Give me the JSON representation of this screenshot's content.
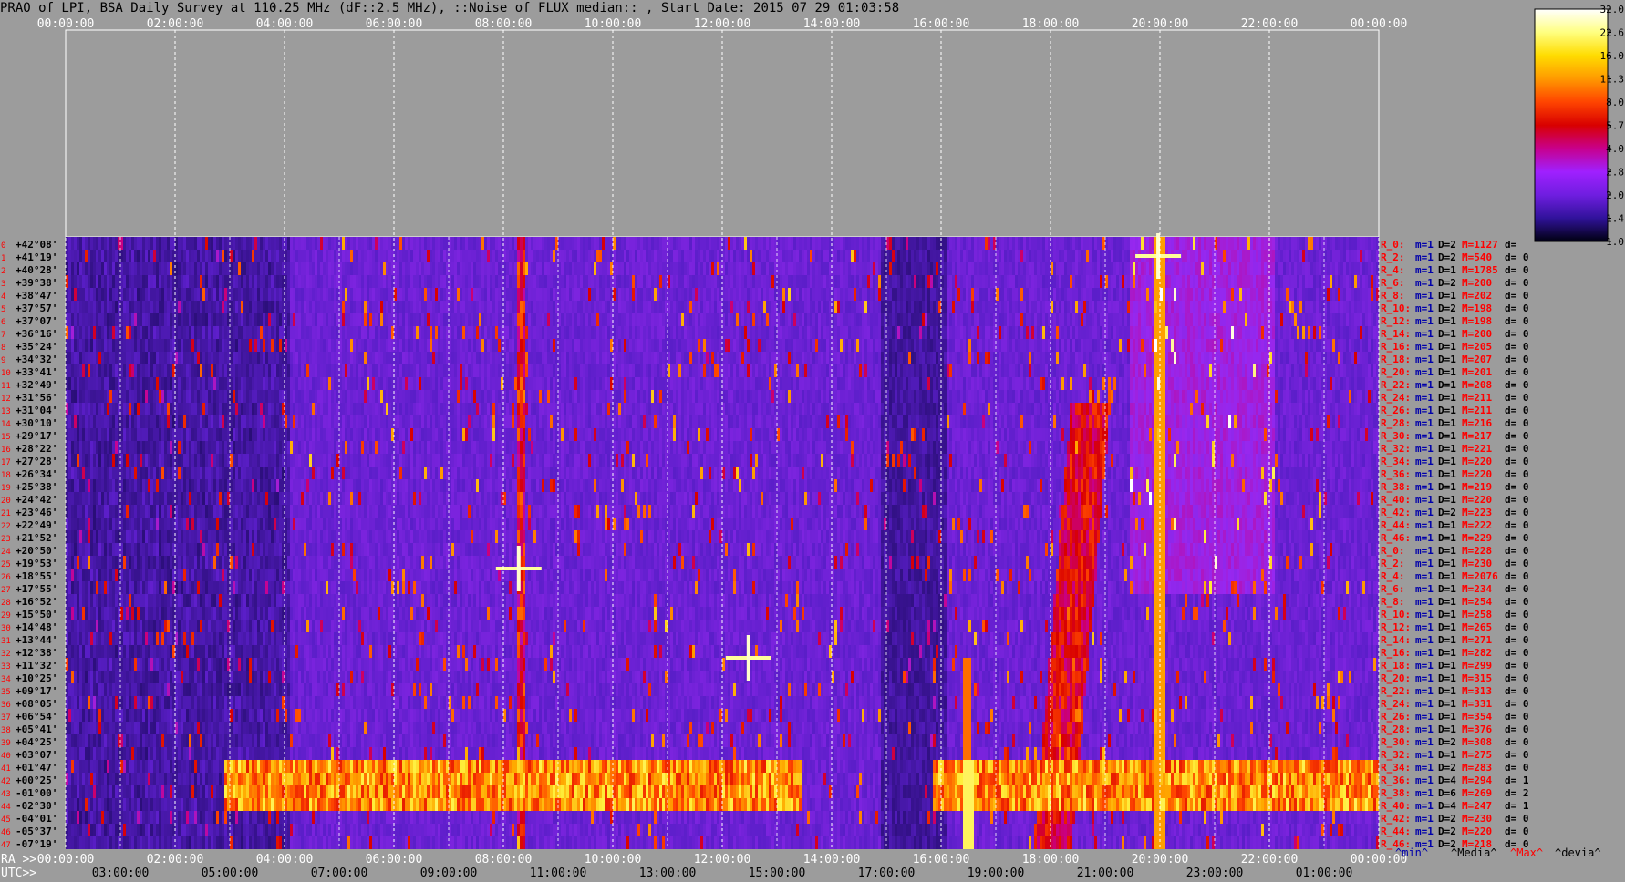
{
  "title": "PRAO of LPI, BSA Daily Survey at 110.25 MHz (dF::2.5 MHz), ::Noise_of_FLUX_median:: , Start Date: 2015 07 29 01:03:58",
  "chart_data": {
    "type": "heatmap",
    "title": "PRAO of LPI, BSA Daily Survey at 110.25 MHz (dF::2.5 MHz), ::Noise_of_FLUX_median:: , Start Date: 2015 07 29 01:03:58",
    "ra_prefix": "RA >>",
    "utc_prefix": "UTC>>",
    "top_ticks": [
      "00:00:00",
      "02:00:00",
      "04:00:00",
      "06:00:00",
      "08:00:00",
      "10:00:00",
      "12:00:00",
      "14:00:00",
      "16:00:00",
      "18:00:00",
      "20:00:00",
      "22:00:00",
      "00:00:00"
    ],
    "bottom_ra_ticks": [
      "00:00:00",
      "02:00:00",
      "04:00:00",
      "06:00:00",
      "08:00:00",
      "10:00:00",
      "12:00:00",
      "14:00:00",
      "16:00:00",
      "18:00:00",
      "20:00:00",
      "22:00:00",
      "00:00:00"
    ],
    "bottom_utc_ticks": [
      "03:00:00",
      "05:00:00",
      "07:00:00",
      "09:00:00",
      "11:00:00",
      "13:00:00",
      "15:00:00",
      "17:00:00",
      "19:00:00",
      "21:00:00",
      "23:00:00",
      "01:00:00"
    ],
    "declinations": [
      "+42°08'",
      "+41°19'",
      "+40°28'",
      "+39°38'",
      "+38°47'",
      "+37°57'",
      "+37°07'",
      "+36°16'",
      "+35°24'",
      "+34°32'",
      "+33°41'",
      "+32°49'",
      "+31°56'",
      "+31°04'",
      "+30°10'",
      "+29°17'",
      "+28°22'",
      "+27°28'",
      "+26°34'",
      "+25°38'",
      "+24°42'",
      "+23°46'",
      "+22°49'",
      "+21°52'",
      "+20°50'",
      "+19°53'",
      "+18°55'",
      "+17°55'",
      "+16°52'",
      "+15°50'",
      "+14°48'",
      "+13°44'",
      "+12°38'",
      "+11°32'",
      "+10°25'",
      "+09°17'",
      "+08°05'",
      "+06°54'",
      "+05°41'",
      "+04°25'",
      "+03°07'",
      "+01°47'",
      "+00°25'",
      "-01°00'",
      "-02°30'",
      "-04°01'",
      "-05°37'",
      "-07°19'"
    ],
    "row_indices": [
      "0",
      "1",
      "2",
      "3",
      "4",
      "5",
      "6",
      "7",
      "8",
      "9",
      "10",
      "11",
      "12",
      "13",
      "14",
      "15",
      "16",
      "17",
      "18",
      "19",
      "20",
      "21",
      "22",
      "23",
      "24",
      "25",
      "26",
      "27",
      "28",
      "29",
      "30",
      "31",
      "32",
      "33",
      "34",
      "35",
      "36",
      "37",
      "38",
      "39",
      "40",
      "41",
      "42",
      "43",
      "44",
      "45",
      "46",
      "47"
    ],
    "colorbar": {
      "ticks": [
        "32.0",
        "22.6",
        "16.0",
        "11.3",
        "8.0",
        "5.7",
        "4.0",
        "2.8",
        "2.0",
        "1.4",
        "1.0"
      ],
      "values": [
        32.0,
        22.6,
        16.0,
        11.3,
        8.0,
        5.7,
        4.0,
        2.8,
        2.0,
        1.4,
        1.0
      ],
      "colors": [
        "#ffffff",
        "#ffff80",
        "#ffdc00",
        "#ff9900",
        "#ff4400",
        "#d80000",
        "#c8008c",
        "#a020ff",
        "#6f1ee0",
        "#30129a",
        "#000010"
      ]
    },
    "stats_header": [
      "^min^",
      "^Media^",
      "^Max^",
      "^devia^"
    ],
    "stats_header_colors": [
      "#0000aa",
      "#000000",
      "#ff0000",
      "#000000"
    ],
    "stats": [
      {
        "label": "R_0:",
        "m": "m=1",
        "D": "D=2",
        "M": "M=1127",
        "d": "d="
      },
      {
        "label": "R_2:",
        "m": "m=1",
        "D": "D=2",
        "M": "M=540",
        "d": "d= 0"
      },
      {
        "label": "R_4:",
        "m": "m=1",
        "D": "D=1",
        "M": "M=1785",
        "d": "d= 0"
      },
      {
        "label": "R_6:",
        "m": "m=1",
        "D": "D=2",
        "M": "M=200",
        "d": "d= 0"
      },
      {
        "label": "R_8:",
        "m": "m=1",
        "D": "D=1",
        "M": "M=202",
        "d": "d= 0"
      },
      {
        "label": "R_10:",
        "m": "m=1",
        "D": "D=2",
        "M": "M=198",
        "d": "d= 0"
      },
      {
        "label": "R_12:",
        "m": "m=1",
        "D": "D=1",
        "M": "M=198",
        "d": "d= 0"
      },
      {
        "label": "R_14:",
        "m": "m=1",
        "D": "D=1",
        "M": "M=200",
        "d": "d= 0"
      },
      {
        "label": "R_16:",
        "m": "m=1",
        "D": "D=1",
        "M": "M=205",
        "d": "d= 0"
      },
      {
        "label": "R_18:",
        "m": "m=1",
        "D": "D=1",
        "M": "M=207",
        "d": "d= 0"
      },
      {
        "label": "R_20:",
        "m": "m=1",
        "D": "D=1",
        "M": "M=201",
        "d": "d= 0"
      },
      {
        "label": "R_22:",
        "m": "m=1",
        "D": "D=1",
        "M": "M=208",
        "d": "d= 0"
      },
      {
        "label": "R_24:",
        "m": "m=1",
        "D": "D=1",
        "M": "M=211",
        "d": "d= 0"
      },
      {
        "label": "R_26:",
        "m": "m=1",
        "D": "D=1",
        "M": "M=211",
        "d": "d= 0"
      },
      {
        "label": "R_28:",
        "m": "m=1",
        "D": "D=1",
        "M": "M=216",
        "d": "d= 0"
      },
      {
        "label": "R_30:",
        "m": "m=1",
        "D": "D=1",
        "M": "M=217",
        "d": "d= 0"
      },
      {
        "label": "R_32:",
        "m": "m=1",
        "D": "D=1",
        "M": "M=221",
        "d": "d= 0"
      },
      {
        "label": "R_34:",
        "m": "m=1",
        "D": "D=1",
        "M": "M=220",
        "d": "d= 0"
      },
      {
        "label": "R_36:",
        "m": "m=1",
        "D": "D=1",
        "M": "M=220",
        "d": "d= 0"
      },
      {
        "label": "R_38:",
        "m": "m=1",
        "D": "D=1",
        "M": "M=219",
        "d": "d= 0"
      },
      {
        "label": "R_40:",
        "m": "m=1",
        "D": "D=1",
        "M": "M=220",
        "d": "d= 0"
      },
      {
        "label": "R_42:",
        "m": "m=1",
        "D": "D=2",
        "M": "M=223",
        "d": "d= 0"
      },
      {
        "label": "R_44:",
        "m": "m=1",
        "D": "D=1",
        "M": "M=222",
        "d": "d= 0"
      },
      {
        "label": "R_46:",
        "m": "m=1",
        "D": "D=1",
        "M": "M=229",
        "d": "d= 0"
      },
      {
        "label": "R_0:",
        "m": "m=1",
        "D": "D=1",
        "M": "M=228",
        "d": "d= 0"
      },
      {
        "label": "R_2:",
        "m": "m=1",
        "D": "D=1",
        "M": "M=230",
        "d": "d= 0"
      },
      {
        "label": "R_4:",
        "m": "m=1",
        "D": "D=1",
        "M": "M=2076",
        "d": "d= 0"
      },
      {
        "label": "R_6:",
        "m": "m=1",
        "D": "D=1",
        "M": "M=234",
        "d": "d= 0"
      },
      {
        "label": "R_8:",
        "m": "m=1",
        "D": "D=1",
        "M": "M=254",
        "d": "d= 0"
      },
      {
        "label": "R_10:",
        "m": "m=1",
        "D": "D=1",
        "M": "M=258",
        "d": "d= 0"
      },
      {
        "label": "R_12:",
        "m": "m=1",
        "D": "D=1",
        "M": "M=265",
        "d": "d= 0"
      },
      {
        "label": "R_14:",
        "m": "m=1",
        "D": "D=1",
        "M": "M=271",
        "d": "d= 0"
      },
      {
        "label": "R_16:",
        "m": "m=1",
        "D": "D=1",
        "M": "M=282",
        "d": "d= 0"
      },
      {
        "label": "R_18:",
        "m": "m=1",
        "D": "D=1",
        "M": "M=299",
        "d": "d= 0"
      },
      {
        "label": "R_20:",
        "m": "m=1",
        "D": "D=1",
        "M": "M=315",
        "d": "d= 0"
      },
      {
        "label": "R_22:",
        "m": "m=1",
        "D": "D=1",
        "M": "M=313",
        "d": "d= 0"
      },
      {
        "label": "R_24:",
        "m": "m=1",
        "D": "D=1",
        "M": "M=331",
        "d": "d= 0"
      },
      {
        "label": "R_26:",
        "m": "m=1",
        "D": "D=1",
        "M": "M=354",
        "d": "d= 0"
      },
      {
        "label": "R_28:",
        "m": "m=1",
        "D": "D=1",
        "M": "M=376",
        "d": "d= 0"
      },
      {
        "label": "R_30:",
        "m": "m=1",
        "D": "D=2",
        "M": "M=308",
        "d": "d= 0"
      },
      {
        "label": "R_32:",
        "m": "m=1",
        "D": "D=1",
        "M": "M=275",
        "d": "d= 0"
      },
      {
        "label": "R_34:",
        "m": "m=1",
        "D": "D=2",
        "M": "M=283",
        "d": "d= 0"
      },
      {
        "label": "R_36:",
        "m": "m=1",
        "D": "D=4",
        "M": "M=294",
        "d": "d= 1"
      },
      {
        "label": "R_38:",
        "m": "m=1",
        "D": "D=6",
        "M": "M=269",
        "d": "d= 2"
      },
      {
        "label": "R_40:",
        "m": "m=1",
        "D": "D=4",
        "M": "M=247",
        "d": "d= 1"
      },
      {
        "label": "R_42:",
        "m": "m=1",
        "D": "D=2",
        "M": "M=230",
        "d": "d= 0"
      },
      {
        "label": "R_44:",
        "m": "m=1",
        "D": "D=2",
        "M": "M=220",
        "d": "d= 0"
      },
      {
        "label": "R_46:",
        "m": "m=1",
        "D": "D=2",
        "M": "M=218",
        "d": "d= 0"
      }
    ],
    "stats_colors": {
      "label": "#ff0000",
      "m": "#0000aa",
      "D": "#000000",
      "M": "#ff0000",
      "d": "#000000"
    },
    "colors": {
      "background": "#9c9c9c",
      "low": "#000010",
      "mid": "#6f1ee0",
      "high": "#ffffff",
      "grid": "#ffffff"
    }
  }
}
